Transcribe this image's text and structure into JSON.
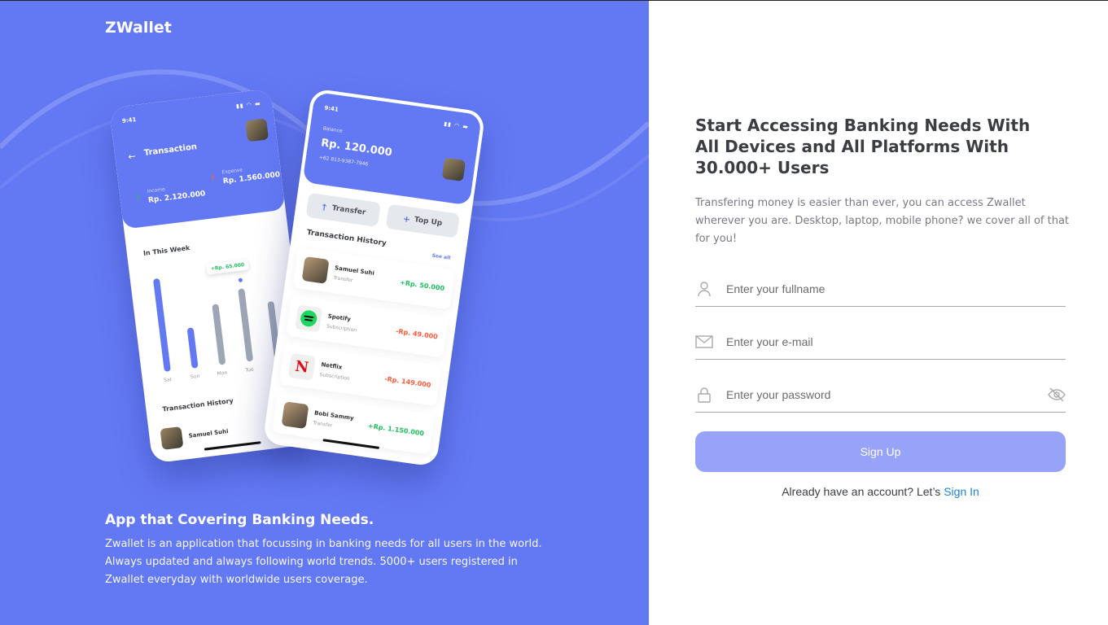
{
  "brand": {
    "logo": "ZWallet",
    "accent": "#6379F4",
    "accent_light": "#96A3F8"
  },
  "mockup": {
    "status_time": "9:41",
    "back_phone": {
      "title": "Transaction",
      "income_label": "Income",
      "income_value": "Rp. 2.120.000",
      "expense_label": "Expense",
      "expense_value": "Rp. 1.560.000",
      "week_title": "In This Week",
      "days": [
        "Sat",
        "Sun",
        "Mon",
        "Tue"
      ],
      "tooltip": "+Rp. 65.000",
      "history_title": "Transaction History",
      "history_first_name": "Samuel Suhi"
    },
    "front_phone": {
      "balance_label": "Balance",
      "balance_value": "Rp. 120.000",
      "phone": "+62 813-9387-7946",
      "transfer_label": "Transfer",
      "topup_label": "Top Up",
      "history_title": "Transaction History",
      "see_all": "See all",
      "transactions": [
        {
          "name": "Samuel Suhi",
          "type": "Transfer",
          "amount": "+Rp. 50.000",
          "icon": "person-avatar"
        },
        {
          "name": "Spotify",
          "type": "Subscription",
          "amount": "-Rp. 49.000",
          "icon": "spotify-logo"
        },
        {
          "name": "Netflix",
          "type": "Subscription",
          "amount": "-Rp. 149.000",
          "icon": "netflix-logo"
        },
        {
          "name": "Bobi Sammy",
          "type": "Transfer",
          "amount": "+Rp. 1.150.000",
          "icon": "person-avatar"
        }
      ]
    }
  },
  "left": {
    "heading": "App that Covering Banking Needs.",
    "description": "Zwallet is an application that focussing in banking needs for all users in the world. Always updated and always following world trends. 5000+ users registered in Zwallet everyday with worldwide users coverage."
  },
  "right": {
    "heading": "Start Accessing Banking Needs With All Devices and All Platforms With 30.000+ Users",
    "description": "Transfering money is easier than ever, you can access Zwallet wherever you are. Desktop, laptop, mobile phone? we cover all of that for you!",
    "fullname_placeholder": "Enter your fullname",
    "email_placeholder": "Enter your e-mail",
    "password_placeholder": "Enter your password",
    "signup_label": "Sign Up",
    "already_text": "Already have an account? Let’s",
    "signin_link": "Sign In"
  }
}
